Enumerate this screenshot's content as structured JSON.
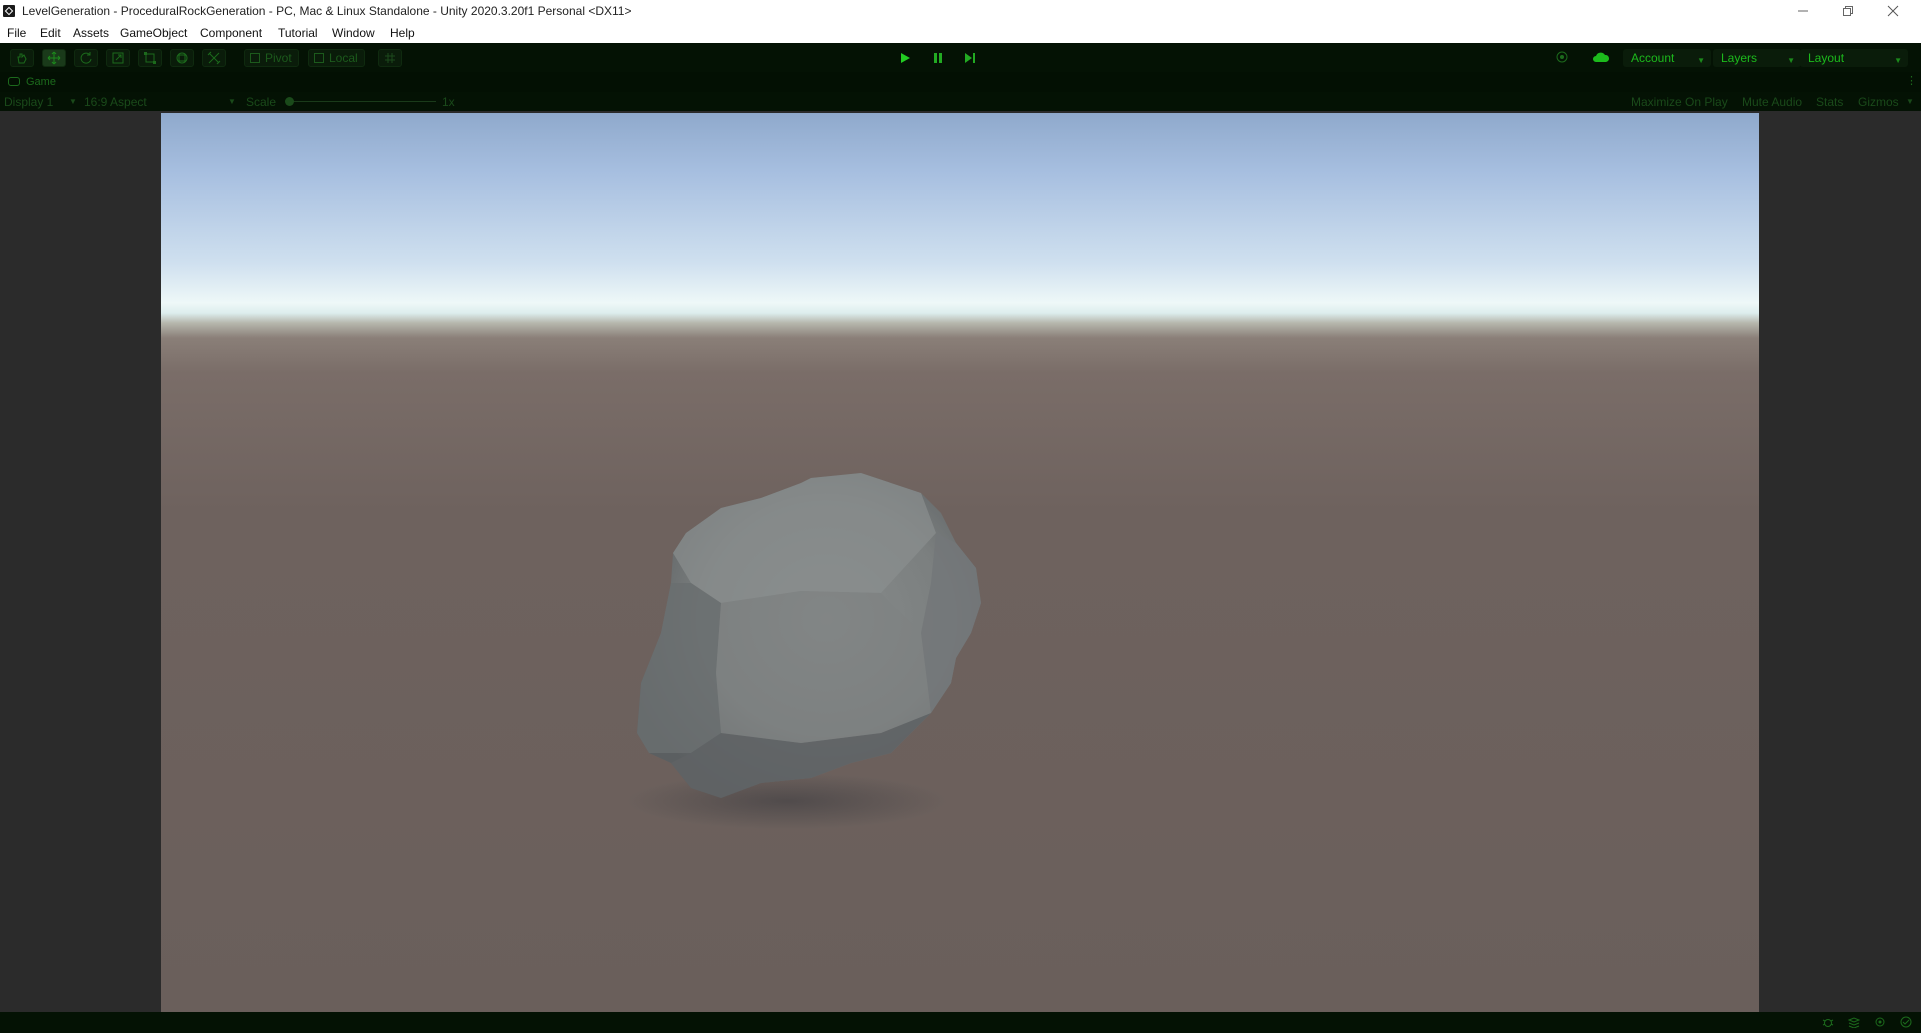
{
  "window": {
    "title": "LevelGeneration - ProceduralRockGeneration - PC, Mac & Linux Standalone - Unity 2020.3.20f1 Personal <DX11>"
  },
  "menu": [
    "File",
    "Edit",
    "Assets",
    "GameObject",
    "Component",
    "Tutorial",
    "Window",
    "Help"
  ],
  "toolbar": {
    "tools": [
      "hand-tool-icon",
      "move-tool-icon",
      "rotate-tool-icon",
      "scale-tool-icon",
      "rect-tool-icon",
      "transform-tool-icon",
      "custom-tool-icon"
    ],
    "pivot_label": "Pivot",
    "local_label": "Local",
    "account_label": "Account",
    "layers_label": "Layers",
    "layout_label": "Layout"
  },
  "game_tab": {
    "label": "Game"
  },
  "game_toolbar": {
    "display": "Display 1",
    "aspect": "16:9 Aspect",
    "scale_label": "Scale",
    "scale_value": "1x",
    "maximize": "Maximize On Play",
    "mute": "Mute Audio",
    "stats": "Stats",
    "gizmos": "Gizmos"
  },
  "colors": {
    "accent": "#1cba1c",
    "toolbar_bg": "#041204",
    "rock": "#7f8383",
    "ground": "#6c605c"
  }
}
